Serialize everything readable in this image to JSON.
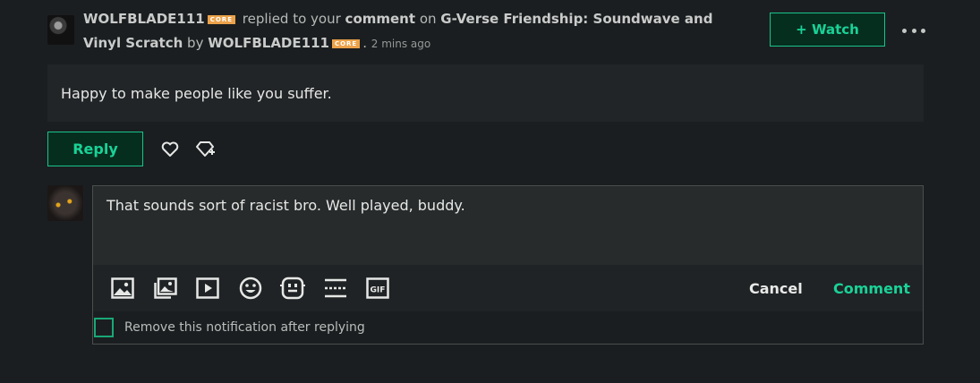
{
  "notification": {
    "actor": "WOLFBLADE111",
    "actor_badge": "CORE",
    "action_text": "replied to your",
    "comment_word": "comment",
    "on_word": "on",
    "deviation_title": "G-Verse Friendship: Soundwave and Vinyl Scratch",
    "by_word": "by",
    "author": "WOLFBLADE111",
    "author_badge": "CORE",
    "timestamp": "2 mins ago",
    "watch_label": "+ Watch",
    "comment_text": "Happy to make people like you suffer."
  },
  "actions": {
    "reply_label": "Reply"
  },
  "editor": {
    "draft_text": "That sounds sort of racist bro. Well played, buddy.",
    "toolbar_icons": [
      "image-icon",
      "gallery-icon",
      "video-icon",
      "emoji-icon",
      "emoticon-icon",
      "divider-icon",
      "gif-icon"
    ],
    "cancel_label": "Cancel",
    "submit_label": "Comment",
    "remove_notification_label": "Remove this notification after replying",
    "remove_notification_checked": false
  },
  "colors": {
    "background": "#1b1e20",
    "accent": "#19d297",
    "badge": "#eca24a"
  }
}
